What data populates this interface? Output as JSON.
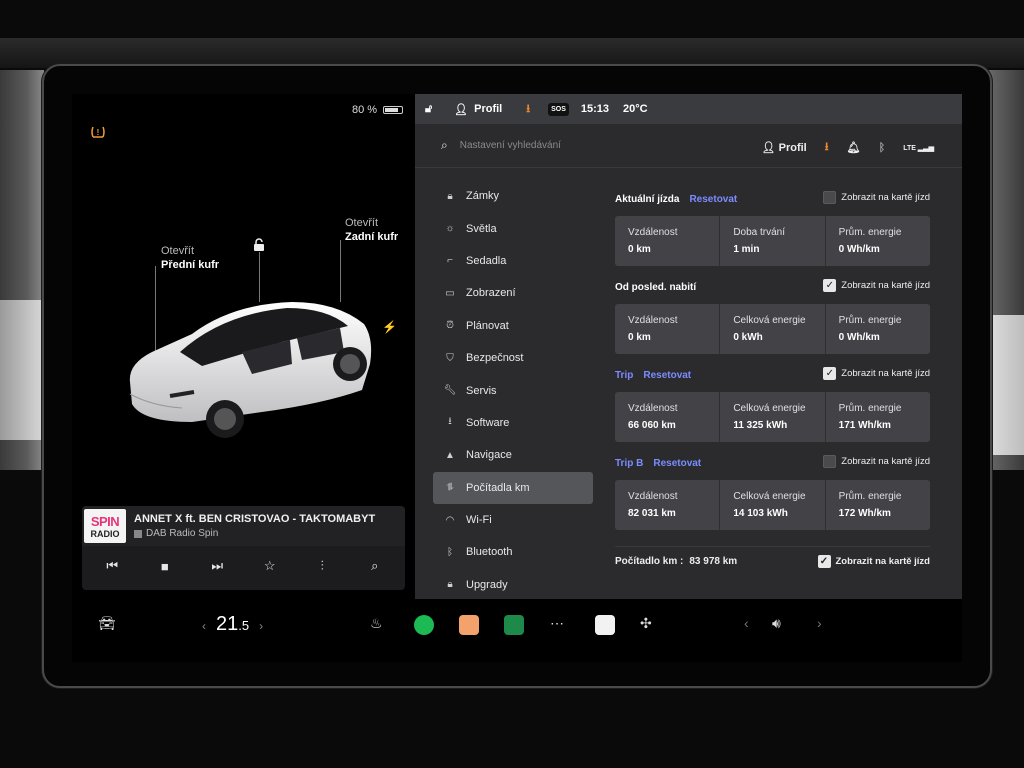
{
  "status": {
    "battery": "80 %",
    "battery_level": 0.8,
    "profile": "Profil",
    "sos": "SOS",
    "time": "15:13",
    "temperature": "20°C"
  },
  "car": {
    "front_trunk": {
      "action": "Otevřít",
      "name": "Přední kufr"
    },
    "rear_trunk": {
      "action": "Otevřít",
      "name": "Zadní kufr"
    }
  },
  "music": {
    "logo_line1": "SPIN",
    "logo_line2": "RADIO",
    "title": "ANNET X ft. BEN CRISTOVAO - TAKTOMABYT",
    "station": "DAB Radio Spin"
  },
  "climate": {
    "temp_main": "21",
    "temp_decimal": ".5"
  },
  "settings": {
    "search_placeholder": "Nastavení vyhledávání",
    "profile": "Profil",
    "network": "LTE",
    "nav": [
      {
        "icon": "lock-icon",
        "label": "Zámky"
      },
      {
        "icon": "sun-icon",
        "label": "Světla"
      },
      {
        "icon": "seat-icon",
        "label": "Sedadla"
      },
      {
        "icon": "display-icon",
        "label": "Zobrazení"
      },
      {
        "icon": "alarm-icon",
        "label": "Plánovat"
      },
      {
        "icon": "shield-icon",
        "label": "Bezpečnost"
      },
      {
        "icon": "wrench-icon",
        "label": "Servis"
      },
      {
        "icon": "download-icon",
        "label": "Software"
      },
      {
        "icon": "navigation-icon",
        "label": "Navigace"
      },
      {
        "icon": "trip-icon",
        "label": "Počítadla km"
      },
      {
        "icon": "wifi-icon",
        "label": "Wi-Fi"
      },
      {
        "icon": "bluetooth-icon",
        "label": "Bluetooth"
      },
      {
        "icon": "upgrade-icon",
        "label": "Upgrady"
      }
    ],
    "active_nav": "Počítadla km",
    "show_on_card_label": "Zobrazit na kartě jízd",
    "reset_label": "Resetovat",
    "sections": [
      {
        "title": "Aktuální jízda",
        "has_reset": true,
        "checked": false,
        "cells": [
          {
            "label": "Vzdálenost",
            "value": "0 km"
          },
          {
            "label": "Doba trvání",
            "value": "1 min"
          },
          {
            "label": "Prům. energie",
            "value": "0 Wh/km"
          }
        ]
      },
      {
        "title": "Od posled. nabití",
        "has_reset": false,
        "checked": true,
        "cells": [
          {
            "label": "Vzdálenost",
            "value": "0 km"
          },
          {
            "label": "Celková energie",
            "value": "0 kWh"
          },
          {
            "label": "Prům. energie",
            "value": "0 Wh/km"
          }
        ]
      },
      {
        "title": "Trip",
        "has_reset": true,
        "checked": true,
        "cells": [
          {
            "label": "Vzdálenost",
            "value": "66 060 km"
          },
          {
            "label": "Celková energie",
            "value": "11 325 kWh"
          },
          {
            "label": "Prům. energie",
            "value": "171 Wh/km"
          }
        ]
      },
      {
        "title": "Trip B",
        "has_reset": true,
        "checked": false,
        "cells": [
          {
            "label": "Vzdálenost",
            "value": "82 031 km"
          },
          {
            "label": "Celková energie",
            "value": "14 103 kWh"
          },
          {
            "label": "Prům. energie",
            "value": "172 Wh/km"
          }
        ]
      }
    ],
    "odometer_label": "Počítadlo km :",
    "odometer_value": "83 978 km",
    "odometer_checked": true
  },
  "colors": {
    "accent_blue": "#7b8cff",
    "download_orange": "#f08a2c",
    "warning_orange": "#f19b3b",
    "radio_pink": "#e6357a",
    "spotify_green": "#1db954"
  }
}
